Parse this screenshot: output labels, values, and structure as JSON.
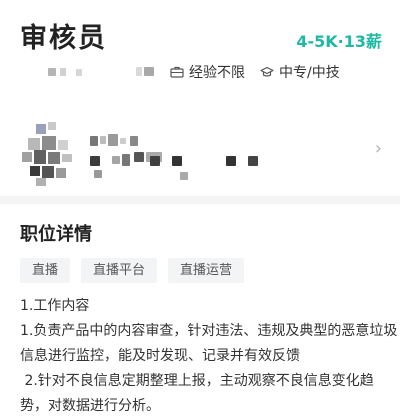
{
  "job": {
    "title": "审核员",
    "salary": "4-5K·13薪"
  },
  "requirements": {
    "experience": "经验不限",
    "education": "中专/中技",
    "experience_icon": "briefcase-icon",
    "education_icon": "graduation-cap-icon"
  },
  "company": {
    "chevron_icon": "chevron-right-icon"
  },
  "details": {
    "section_title": "职位详情",
    "tags": [
      "直播",
      "直播平台",
      "直播运营"
    ],
    "lines": [
      "1.工作内容",
      "1.负责产品中的内容审查，针对违法、违规及典型的恶意垃圾",
      "信息进行监控，能及时发现、记录并有效反馈",
      " 2.针对不良信息定期整理上报，主动观察不良信息变化趋",
      "势，对数据进行分析。"
    ]
  },
  "colors": {
    "salary": "#1fb8a5",
    "tag_bg": "#f3f4f6",
    "divider": "#f5f5f5"
  }
}
